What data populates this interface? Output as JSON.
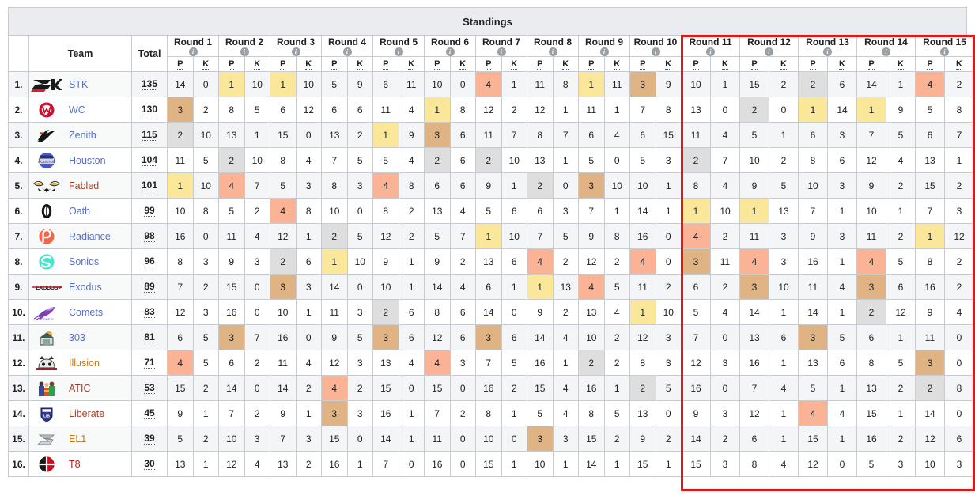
{
  "header": {
    "title": "Standings"
  },
  "table": {
    "columns": {
      "rank": "",
      "team": "Team",
      "total": "Total",
      "sub_points": "P",
      "sub_kills": "K",
      "info_glyph": "i"
    },
    "rounds": [
      "Round 1",
      "Round 2",
      "Round 3",
      "Round 4",
      "Round 5",
      "Round 6",
      "Round 7",
      "Round 8",
      "Round 9",
      "Round 10",
      "Round 11",
      "Round 12",
      "Round 13",
      "Round 14",
      "Round 15"
    ],
    "highlight_colors": {
      "first": "#fbe79a",
      "second": "#dedede",
      "third": "#dfb383",
      "fourth": "#fbb396",
      "focus_border": "#ee1111"
    },
    "rows": [
      {
        "rank": "1.",
        "team": "STK",
        "total": "135",
        "logo": "stk-logo",
        "name_color": "#5a6fc0",
        "cells": [
          14,
          0,
          1,
          10,
          1,
          10,
          5,
          9,
          6,
          11,
          10,
          0,
          4,
          1,
          11,
          8,
          1,
          11,
          3,
          9,
          10,
          1,
          15,
          2,
          2,
          6,
          14,
          1,
          4,
          2
        ]
      },
      {
        "rank": "2.",
        "team": "WC",
        "total": "130",
        "logo": "wc-logo",
        "name_color": "#5a6fc0",
        "cells": [
          3,
          2,
          8,
          5,
          6,
          12,
          6,
          6,
          11,
          4,
          1,
          8,
          12,
          2,
          12,
          1,
          11,
          1,
          7,
          8,
          13,
          0,
          2,
          0,
          1,
          14,
          1,
          9,
          5,
          8
        ]
      },
      {
        "rank": "3.",
        "team": "Zenith",
        "total": "115",
        "logo": "zenith-logo",
        "name_color": "#5a6fc0",
        "cells": [
          2,
          10,
          13,
          1,
          15,
          0,
          13,
          2,
          1,
          9,
          3,
          6,
          11,
          7,
          8,
          7,
          6,
          4,
          6,
          15,
          11,
          4,
          5,
          1,
          6,
          3,
          7,
          5,
          6,
          7
        ]
      },
      {
        "rank": "4.",
        "team": "Houston",
        "total": "104",
        "logo": "houston-logo",
        "name_color": "#5a6fc0",
        "cells": [
          11,
          5,
          2,
          10,
          8,
          4,
          7,
          5,
          5,
          4,
          2,
          6,
          2,
          10,
          13,
          1,
          5,
          0,
          5,
          3,
          2,
          7,
          10,
          2,
          8,
          6,
          12,
          4,
          13,
          1
        ]
      },
      {
        "rank": "5.",
        "team": "Fabled",
        "total": "101",
        "logo": "fabled-logo",
        "name_color": "#a0432a",
        "cells": [
          1,
          10,
          4,
          7,
          5,
          3,
          8,
          3,
          4,
          8,
          6,
          6,
          9,
          1,
          2,
          0,
          3,
          10,
          10,
          1,
          8,
          4,
          9,
          5,
          10,
          3,
          9,
          2,
          15,
          2
        ]
      },
      {
        "rank": "6.",
        "team": "Oath",
        "total": "99",
        "logo": "oath-logo",
        "name_color": "#5a6fc0",
        "cells": [
          10,
          8,
          5,
          2,
          4,
          8,
          10,
          0,
          8,
          2,
          13,
          4,
          5,
          6,
          6,
          3,
          7,
          1,
          14,
          1,
          1,
          10,
          1,
          13,
          7,
          1,
          10,
          1,
          7,
          3
        ]
      },
      {
        "rank": "7.",
        "team": "Radiance",
        "total": "98",
        "logo": "radiance-logo",
        "name_color": "#5a6fc0",
        "cells": [
          16,
          0,
          11,
          4,
          12,
          1,
          2,
          5,
          12,
          2,
          5,
          7,
          1,
          10,
          7,
          5,
          9,
          8,
          16,
          0,
          4,
          2,
          11,
          3,
          9,
          3,
          11,
          2,
          1,
          12
        ]
      },
      {
        "rank": "8.",
        "team": "Soniqs",
        "total": "96",
        "logo": "soniqs-logo",
        "name_color": "#5a6fc0",
        "cells": [
          8,
          3,
          9,
          3,
          2,
          6,
          1,
          10,
          9,
          1,
          9,
          2,
          13,
          6,
          4,
          2,
          12,
          2,
          4,
          0,
          3,
          11,
          4,
          3,
          16,
          1,
          4,
          5,
          8,
          2
        ]
      },
      {
        "rank": "9.",
        "team": "Exodus",
        "total": "89",
        "logo": "exodus-logo",
        "name_color": "#5a6fc0",
        "cells": [
          7,
          2,
          15,
          0,
          3,
          3,
          14,
          0,
          10,
          1,
          14,
          4,
          6,
          1,
          1,
          13,
          4,
          5,
          11,
          2,
          6,
          2,
          3,
          10,
          11,
          4,
          3,
          6,
          16,
          2
        ]
      },
      {
        "rank": "10.",
        "team": "Comets",
        "total": "83",
        "logo": "comets-logo",
        "name_color": "#5a6fc0",
        "cells": [
          12,
          3,
          16,
          0,
          10,
          1,
          11,
          3,
          2,
          6,
          8,
          6,
          14,
          0,
          9,
          2,
          13,
          4,
          1,
          10,
          5,
          4,
          14,
          1,
          14,
          1,
          2,
          12,
          9,
          4
        ]
      },
      {
        "rank": "11.",
        "team": "303",
        "total": "81",
        "logo": "t303-logo",
        "name_color": "#5a6fc0",
        "cells": [
          6,
          5,
          3,
          7,
          16,
          0,
          9,
          5,
          3,
          6,
          12,
          6,
          3,
          6,
          14,
          4,
          10,
          2,
          12,
          3,
          7,
          0,
          13,
          6,
          3,
          5,
          6,
          1,
          11,
          0
        ]
      },
      {
        "rank": "12.",
        "team": "Illusion",
        "total": "71",
        "logo": "illusion-logo",
        "name_color": "#c07a22",
        "cells": [
          4,
          5,
          6,
          2,
          11,
          4,
          12,
          3,
          13,
          4,
          4,
          3,
          7,
          5,
          16,
          1,
          2,
          2,
          8,
          3,
          12,
          3,
          16,
          1,
          13,
          6,
          8,
          5,
          3,
          0
        ]
      },
      {
        "rank": "13.",
        "team": "ATIC",
        "total": "53",
        "logo": "atic-logo",
        "name_color": "#a0432a",
        "cells": [
          15,
          2,
          14,
          0,
          14,
          2,
          4,
          2,
          15,
          0,
          15,
          0,
          16,
          2,
          15,
          4,
          16,
          1,
          2,
          5,
          16,
          0,
          7,
          4,
          5,
          1,
          13,
          2,
          2,
          8
        ]
      },
      {
        "rank": "14.",
        "team": "Liberate",
        "total": "45",
        "logo": "liberate-logo",
        "name_color": "#a0432a",
        "cells": [
          9,
          1,
          7,
          2,
          9,
          1,
          3,
          3,
          16,
          1,
          7,
          2,
          8,
          1,
          5,
          4,
          8,
          5,
          13,
          0,
          9,
          3,
          12,
          1,
          4,
          4,
          15,
          1,
          14,
          0
        ]
      },
      {
        "rank": "15.",
        "team": "EL1",
        "total": "39",
        "logo": "el1-logo",
        "name_color": "#c07a22",
        "cells": [
          5,
          2,
          10,
          3,
          7,
          3,
          15,
          0,
          14,
          1,
          11,
          0,
          10,
          0,
          3,
          3,
          15,
          2,
          9,
          2,
          14,
          2,
          6,
          1,
          15,
          1,
          16,
          2,
          12,
          6
        ]
      },
      {
        "rank": "16.",
        "team": "T8",
        "total": "30",
        "logo": "t8-logo",
        "name_color": "#b52020",
        "cells": [
          13,
          1,
          12,
          4,
          13,
          2,
          16,
          1,
          7,
          0,
          16,
          0,
          15,
          1,
          10,
          1,
          14,
          1,
          15,
          1,
          15,
          3,
          8,
          4,
          12,
          0,
          5,
          3,
          10,
          3
        ]
      }
    ]
  }
}
